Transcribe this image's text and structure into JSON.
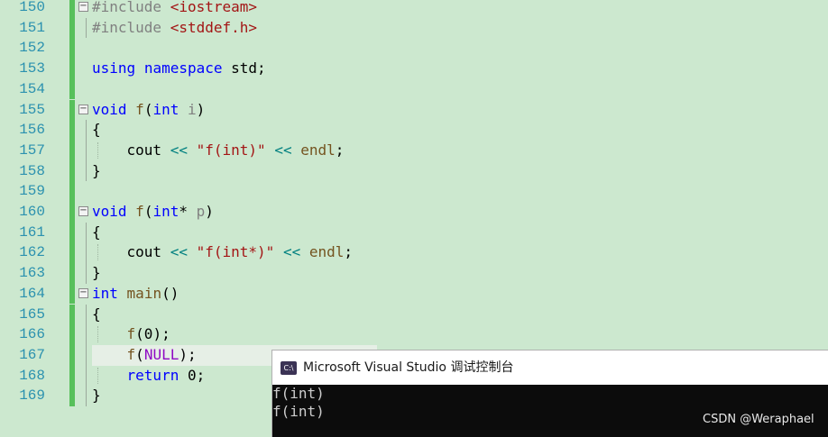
{
  "editor": {
    "lines": [
      {
        "number": "150",
        "parts": [
          [
            "pp",
            "#include "
          ],
          [
            "inc",
            "<iostream>"
          ]
        ]
      },
      {
        "number": "151",
        "parts": [
          [
            "pp",
            "#include "
          ],
          [
            "inc",
            "<stddef.h>"
          ]
        ]
      },
      {
        "number": "152",
        "parts": []
      },
      {
        "number": "153",
        "parts": [
          [
            "kw",
            "using"
          ],
          [
            "pl",
            " "
          ],
          [
            "kw",
            "namespace"
          ],
          [
            "pl",
            " std;"
          ]
        ]
      },
      {
        "number": "154",
        "parts": []
      },
      {
        "number": "155",
        "parts": [
          [
            "kw",
            "void"
          ],
          [
            "pl",
            " "
          ],
          [
            "fn",
            "f"
          ],
          [
            "pl",
            "("
          ],
          [
            "kw",
            "int"
          ],
          [
            "pl",
            " "
          ],
          [
            "prm",
            "i"
          ],
          [
            "pl",
            ")"
          ]
        ]
      },
      {
        "number": "156",
        "parts": [
          [
            "pl",
            "{"
          ]
        ]
      },
      {
        "number": "157",
        "parts": [
          [
            "pl",
            "    cout "
          ],
          [
            "op",
            "<<"
          ],
          [
            "pl",
            " "
          ],
          [
            "str",
            "\"f(int)\""
          ],
          [
            "pl",
            " "
          ],
          [
            "op",
            "<<"
          ],
          [
            "pl",
            " "
          ],
          [
            "fn",
            "endl"
          ],
          [
            "pl",
            ";"
          ]
        ]
      },
      {
        "number": "158",
        "parts": [
          [
            "pl",
            "}"
          ]
        ]
      },
      {
        "number": "159",
        "parts": []
      },
      {
        "number": "160",
        "parts": [
          [
            "kw",
            "void"
          ],
          [
            "pl",
            " "
          ],
          [
            "fn",
            "f"
          ],
          [
            "pl",
            "("
          ],
          [
            "kw",
            "int"
          ],
          [
            "pl",
            "* "
          ],
          [
            "prm",
            "p"
          ],
          [
            "pl",
            ")"
          ]
        ]
      },
      {
        "number": "161",
        "parts": [
          [
            "pl",
            "{"
          ]
        ]
      },
      {
        "number": "162",
        "parts": [
          [
            "pl",
            "    cout "
          ],
          [
            "op",
            "<<"
          ],
          [
            "pl",
            " "
          ],
          [
            "str",
            "\"f(int*)\""
          ],
          [
            "pl",
            " "
          ],
          [
            "op",
            "<<"
          ],
          [
            "pl",
            " "
          ],
          [
            "fn",
            "endl"
          ],
          [
            "pl",
            ";"
          ]
        ]
      },
      {
        "number": "163",
        "parts": [
          [
            "pl",
            "}"
          ]
        ]
      },
      {
        "number": "164",
        "parts": [
          [
            "kw",
            "int"
          ],
          [
            "pl",
            " "
          ],
          [
            "fn",
            "main"
          ],
          [
            "pl",
            "()"
          ]
        ]
      },
      {
        "number": "165",
        "parts": [
          [
            "pl",
            "{"
          ]
        ]
      },
      {
        "number": "166",
        "parts": [
          [
            "pl",
            "    "
          ],
          [
            "fn",
            "f"
          ],
          [
            "pl",
            "(0);"
          ]
        ]
      },
      {
        "number": "167",
        "parts": [
          [
            "pl",
            "    "
          ],
          [
            "fn",
            "f"
          ],
          [
            "pl",
            "("
          ],
          [
            "mac",
            "NULL"
          ],
          [
            "pl",
            ");"
          ]
        ]
      },
      {
        "number": "168",
        "parts": [
          [
            "pl",
            "    "
          ],
          [
            "kw",
            "return"
          ],
          [
            "pl",
            " 0;"
          ]
        ]
      },
      {
        "number": "169",
        "parts": [
          [
            "pl",
            "}"
          ]
        ]
      }
    ]
  },
  "console": {
    "icon_text": "C:\\",
    "title": "Microsoft Visual Studio 调试控制台",
    "output": [
      "f(int)",
      "f(int)"
    ]
  },
  "watermark": "CSDN @Weraphael",
  "colors": {
    "background": "#cce8cf",
    "keyword": "#0000ff",
    "string": "#a31515",
    "line_number": "#2b91af",
    "change_bar": "#57c05b"
  }
}
